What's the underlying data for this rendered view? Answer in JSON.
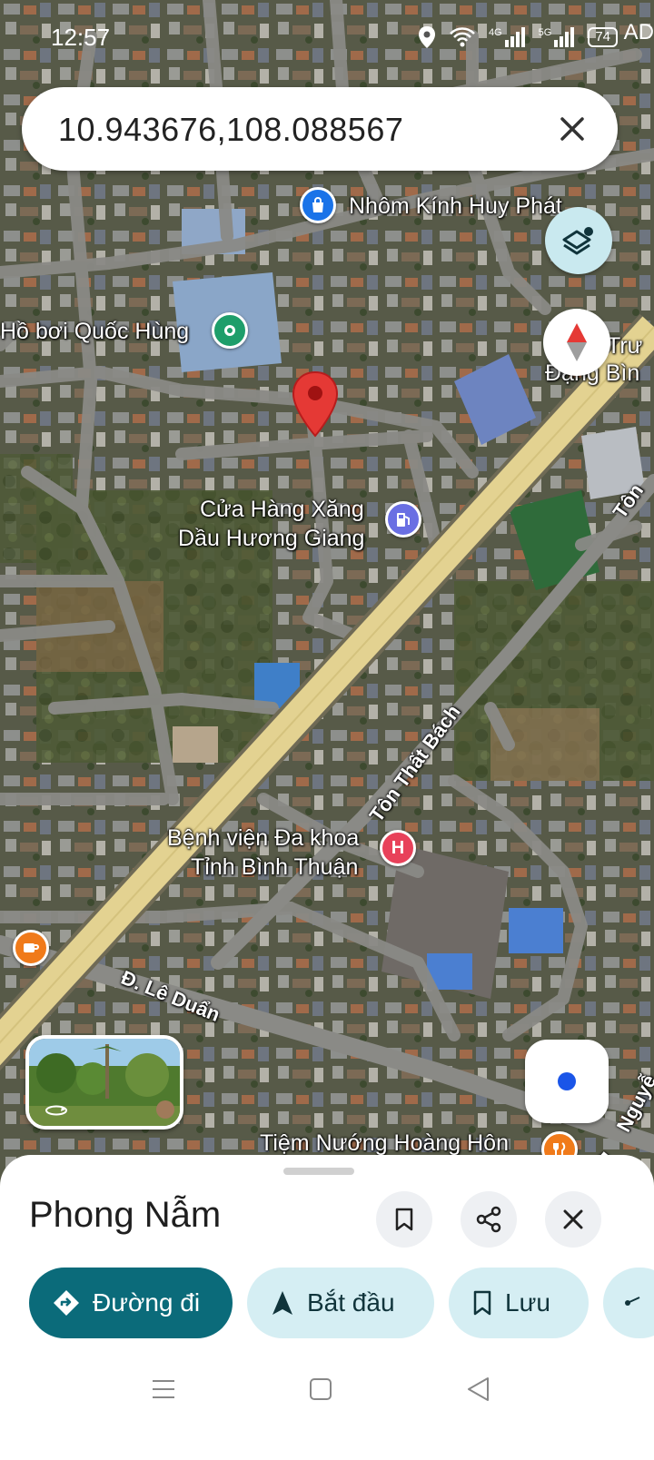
{
  "status_bar": {
    "time": "12:57",
    "network_1": "4G",
    "network_2": "5G",
    "battery": "74",
    "extra": "AD"
  },
  "search": {
    "query": "10.943676,108.088567"
  },
  "map": {
    "labels": {
      "nhom_kinh": "Nhôm Kính Huy Phát",
      "ho_boi": "Hồ bơi Quốc Hùng",
      "cua_hang_xang_line1": "Cửa Hàng Xăng",
      "cua_hang_xang_line2": "Dầu Hương Giang",
      "benh_vien_line1": "Bệnh viện Đa khoa",
      "benh_vien_line2": "Tỉnh Bình Thuận",
      "tiem_nuong": "Tiệm Nướng Hoàng Hôn",
      "truong_line1": "Trư",
      "truong_line2": "Đặng Bìn",
      "road_ton_that_bach": "Tôn Thất Bách",
      "road_ton_edge": "Tôn",
      "road_le_duan": "Đ. Lê Duẩn",
      "road_nguyen_edge": "Nguyễ",
      "road_d_edge": "Đ."
    },
    "hospital_letter": "H",
    "icons": [
      "shopping-bag-icon",
      "park-icon",
      "gas-station-icon",
      "hospital-icon",
      "coffee-icon",
      "restaurant-icon",
      "location-pin-icon"
    ],
    "colors": {
      "main_road": "#e3d291",
      "minor_road": "#8a8a86",
      "pin": "#e53935",
      "hospital": "#e8415a",
      "gas": "#6a6fe3",
      "park": "#1e9e6a",
      "shop": "#1a73e8",
      "food": "#f07a1a"
    }
  },
  "sheet": {
    "title": "Phong Nẫm",
    "directions_label": "Đường đi",
    "start_label": "Bắt đầu",
    "save_label": "Lưu"
  }
}
